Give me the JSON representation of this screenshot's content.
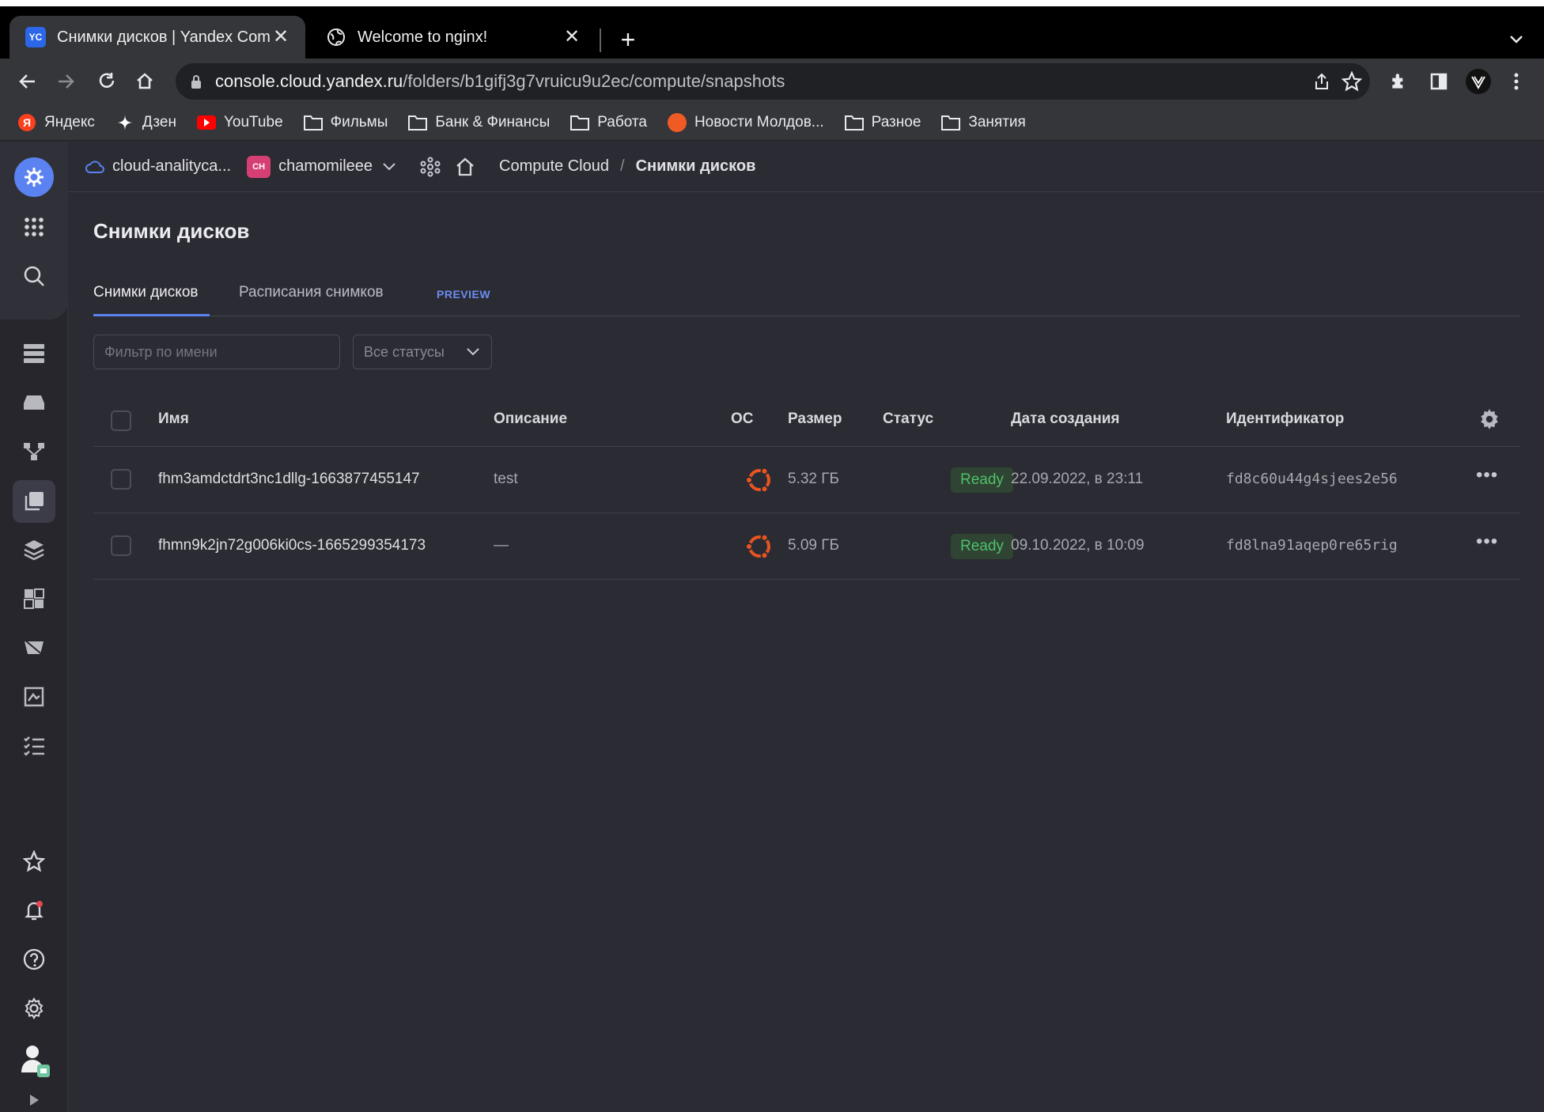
{
  "browser": {
    "tabs": [
      {
        "title": "Снимки дисков | Yandex Comp",
        "favicon": "YC",
        "active": true
      },
      {
        "title": "Welcome to nginx!",
        "favicon": "globe-icon",
        "active": false
      }
    ],
    "url_host": "console.cloud.yandex.ru",
    "url_path": "/folders/b1gifj3g7vruicu9u2ec/compute/snapshots",
    "bookmarks": [
      {
        "label": "Яндекс",
        "icon": "yandex-icon"
      },
      {
        "label": "Дзен",
        "icon": "dzen-icon"
      },
      {
        "label": "YouTube",
        "icon": "youtube-icon"
      },
      {
        "label": "Фильмы",
        "icon": "folder-icon"
      },
      {
        "label": "Банк & Финансы",
        "icon": "folder-icon"
      },
      {
        "label": "Работа",
        "icon": "folder-icon"
      },
      {
        "label": "Новости Молдов...",
        "icon": "news-icon"
      },
      {
        "label": "Разное",
        "icon": "folder-icon"
      },
      {
        "label": "Занятия",
        "icon": "folder-icon"
      }
    ]
  },
  "breadcrumbs": {
    "cloud": "cloud-analityca...",
    "folder_badge": "CH",
    "folder": "chamomileee",
    "service": "Compute Cloud",
    "separator": "/",
    "current": "Снимки дисков"
  },
  "page": {
    "title": "Снимки дисков",
    "tabs": [
      {
        "label": "Снимки дисков",
        "active": true
      },
      {
        "label": "Расписания снимков",
        "active": false,
        "badge": "PREVIEW"
      }
    ],
    "filter_placeholder": "Фильтр по имени",
    "status_filter": "Все статусы"
  },
  "table": {
    "columns": [
      "Имя",
      "Описание",
      "ОС",
      "Размер",
      "Статус",
      "Дата создания",
      "Идентификатор"
    ],
    "rows": [
      {
        "name": "fhm3amdctdrt3nc1dllg-1663877455147",
        "description": "test",
        "os": "ubuntu-icon",
        "size": "5.32 ГБ",
        "status": "Ready",
        "created": "22.09.2022, в 23:11",
        "id": "fd8c60u44g4sjees2e56"
      },
      {
        "name": "fhmn9k2jn72g006ki0cs-1665299354173",
        "description": "—",
        "os": "ubuntu-icon",
        "size": "5.09 ГБ",
        "status": "Ready",
        "created": "09.10.2022, в 10:09",
        "id": "fd8lna91aqep0re65rig"
      }
    ]
  },
  "colors": {
    "accent": "#5a82f0",
    "status_ready_text": "#4ec16a",
    "status_ready_bg": "#2f4433",
    "ubuntu": "#e95420",
    "background": "#2b2b33"
  }
}
